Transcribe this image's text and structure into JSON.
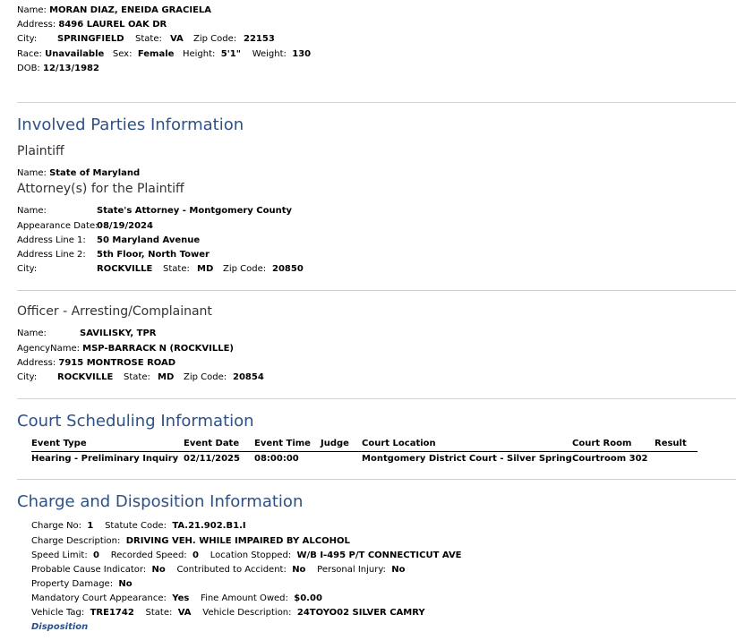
{
  "defendant": {
    "name_label": "Name:",
    "name": "MORAN DIAZ, ENEIDA GRACIELA",
    "address_label": "Address:",
    "address": "8496 LAUREL OAK DR",
    "city_label": "City:",
    "city": "SPRINGFIELD",
    "state_label": "State:",
    "state": "VA",
    "zip_label": "Zip Code:",
    "zip": "22153",
    "race_label": "Race:",
    "race": "Unavailable",
    "sex_label": "Sex:",
    "sex": "Female",
    "height_label": "Height:",
    "height": "5'1\"",
    "weight_label": "Weight:",
    "weight": "130",
    "dob_label": "DOB:",
    "dob": "12/13/1982"
  },
  "involved": {
    "heading": "Involved Parties Information",
    "plaintiff_heading": "Plaintiff",
    "plaintiff_name_label": "Name:",
    "plaintiff_name": "State of Maryland",
    "attorney_heading": "Attorney(s) for the Plaintiff",
    "attorney": {
      "name_label": "Name:",
      "name": "State's Attorney - Montgomery County",
      "appearance_label": "Appearance Date:",
      "appearance": "08/19/2024",
      "addr1_label": "Address Line 1:",
      "addr1": "50 Maryland Avenue",
      "addr2_label": "Address Line 2:",
      "addr2": "5th Floor, North Tower",
      "city_label": "City:",
      "city": "ROCKVILLE",
      "state_label": "State:",
      "state": "MD",
      "zip_label": "Zip Code:",
      "zip": "20850"
    },
    "officer_heading": "Officer - Arresting/Complainant",
    "officer": {
      "name_label": "Name:",
      "name": "SAVILISKY, TPR",
      "agency_label": "AgencyName:",
      "agency": "MSP-BARRACK N (ROCKVILLE)",
      "address_label": "Address:",
      "address": "7915 MONTROSE ROAD",
      "city_label": "City:",
      "city": "ROCKVILLE",
      "state_label": "State:",
      "state": "MD",
      "zip_label": "Zip Code:",
      "zip": "20854"
    }
  },
  "scheduling": {
    "heading": "Court Scheduling Information",
    "columns": [
      "Event Type",
      "Event Date",
      "Event Time",
      "Judge",
      "Court Location",
      "Court Room",
      "Result"
    ],
    "rows": [
      [
        "Hearing - Preliminary Inquiry",
        "02/11/2025",
        "08:00:00",
        "",
        "Montgomery District Court - Silver Spring",
        "Courtroom 302",
        ""
      ]
    ]
  },
  "charge": {
    "heading": "Charge and Disposition Information",
    "charge_no_label": "Charge No:",
    "charge_no": "1",
    "statute_label": "Statute Code:",
    "statute": "TA.21.902.B1.I",
    "desc_label": "Charge Description:",
    "desc": "DRIVING VEH. WHILE IMPAIRED BY ALCOHOL",
    "speed_limit_label": "Speed Limit:",
    "speed_limit": "0",
    "recorded_speed_label": "Recorded Speed:",
    "recorded_speed": "0",
    "location_label": "Location Stopped:",
    "location": "W/B I-495 P/T CONNECTICUT AVE",
    "probable_label": "Probable Cause Indicator:",
    "probable": "No",
    "contrib_label": "Contributed to Accident:",
    "contrib": "No",
    "injury_label": "Personal Injury:",
    "injury": "No",
    "property_label": "Property Damage:",
    "property": "No",
    "mandatory_label": "Mandatory Court Appearance:",
    "mandatory": "Yes",
    "fine_label": "Fine Amount Owed:",
    "fine": "$0.00",
    "tag_label": "Vehicle Tag:",
    "tag": "TRE1742",
    "vstate_label": "State:",
    "vstate": "VA",
    "vdesc_label": "Vehicle Description:",
    "vdesc": "24TOYO02 SILVER CAMRY",
    "disposition_label": "Disposition"
  }
}
